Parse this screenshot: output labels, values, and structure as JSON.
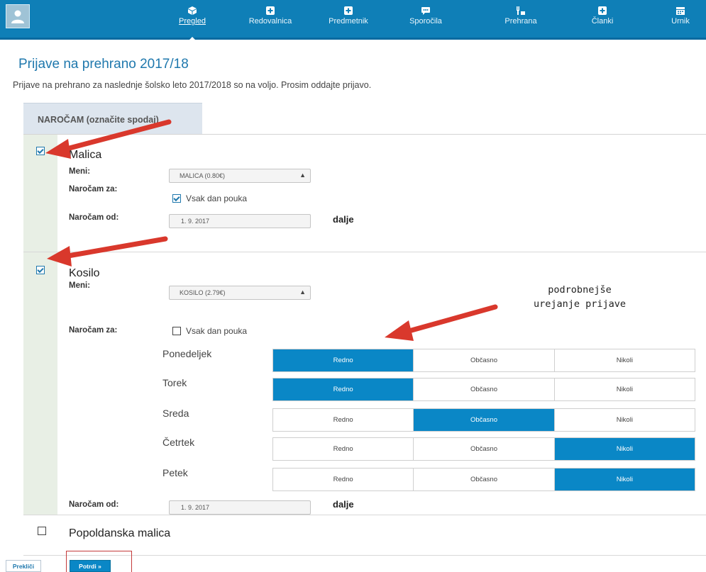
{
  "nav": {
    "items": [
      {
        "label": "Pregled",
        "icon": "cube-icon",
        "active": true
      },
      {
        "label": "Redovalnica",
        "icon": "plus-square-icon",
        "active": false
      },
      {
        "label": "Predmetnik",
        "icon": "plus-square-icon",
        "active": false
      },
      {
        "label": "Sporočila",
        "icon": "chat-bubble-icon",
        "active": false
      },
      {
        "label": "Prehrana",
        "icon": "food-icon",
        "active": false
      },
      {
        "label": "Članki",
        "icon": "plus-square-icon",
        "active": false
      },
      {
        "label": "Urnik",
        "icon": "calendar-icon",
        "active": false
      }
    ]
  },
  "page": {
    "title": "Prijave na prehrano 2017/18",
    "intro": "Prijave na prehrano za naslednje šolsko leto 2017/2018 so na voljo. Prosim oddajte prijavo."
  },
  "tab": {
    "label": "NAROČAM (označite spodaj)"
  },
  "labels": {
    "meni": "Meni:",
    "narocam_za": "Naročam za:",
    "narocam_od": "Naročam od:",
    "vsak_dan": "Vsak dan pouka",
    "dalje": "dalje"
  },
  "malica": {
    "title": "Malica",
    "checked": true,
    "menu": "MALICA (0.80€)",
    "vsak_dan_checked": true,
    "od": "1. 9. 2017"
  },
  "kosilo": {
    "title": "Kosilo",
    "checked": true,
    "menu": "KOSILO (2.79€)",
    "vsak_dan_checked": false,
    "od": "1. 9. 2017",
    "options": [
      "Redno",
      "Občasno",
      "Nikoli"
    ],
    "days": [
      {
        "name": "Ponedeljek",
        "selected": "Redno"
      },
      {
        "name": "Torek",
        "selected": "Redno"
      },
      {
        "name": "Sreda",
        "selected": "Občasno"
      },
      {
        "name": "Četrtek",
        "selected": "Nikoli"
      },
      {
        "name": "Petek",
        "selected": "Nikoli"
      }
    ]
  },
  "popoldanska": {
    "title": "Popoldanska malica",
    "checked": false
  },
  "annotation": {
    "line1": "podrobnejše",
    "line2": "urejanje prijave"
  },
  "buttons": {
    "cancel": "Prekliči",
    "confirm": "Potrdi »"
  },
  "colors": {
    "primary": "#0a87c6",
    "navbar": "#0f7fb7",
    "arrow": "#d9382c",
    "highlight_box": "#c43a3a"
  }
}
